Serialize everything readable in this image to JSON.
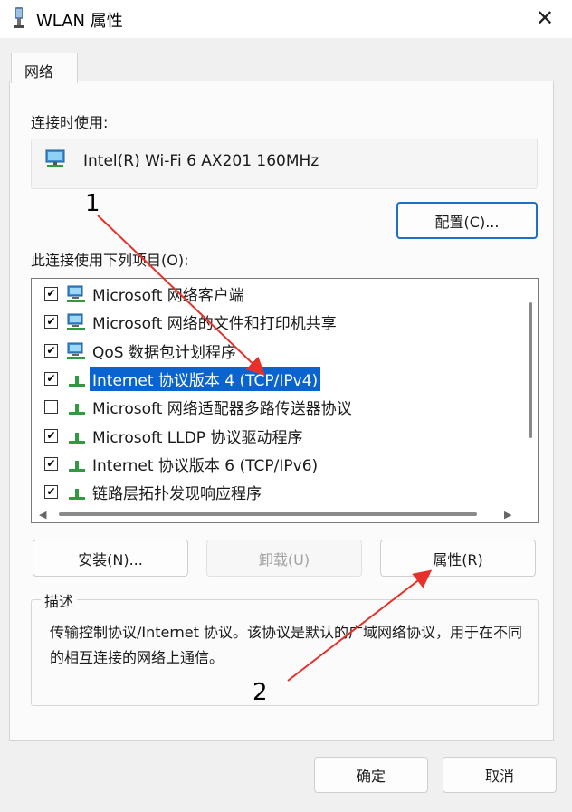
{
  "window": {
    "title": "WLAN 属性",
    "close_glyph": "✕"
  },
  "tabs": [
    {
      "label": "网络"
    }
  ],
  "connect_using": {
    "label": "连接时使用:",
    "adapter_name": "Intel(R) Wi-Fi 6 AX201 160MHz",
    "adapter_icon": "network-adapter-icon",
    "configure_button": "配置(C)..."
  },
  "items_section": {
    "label": "此连接使用下列项目(O):",
    "items": [
      {
        "checked": true,
        "icon": "client-network-icon",
        "label": "Microsoft 网络客户端",
        "selected": false
      },
      {
        "checked": true,
        "icon": "file-share-icon",
        "label": "Microsoft 网络的文件和打印机共享",
        "selected": false
      },
      {
        "checked": true,
        "icon": "qos-icon",
        "label": "QoS 数据包计划程序",
        "selected": false
      },
      {
        "checked": true,
        "icon": "protocol-icon",
        "label": "Internet 协议版本 4 (TCP/IPv4)",
        "selected": true
      },
      {
        "checked": false,
        "icon": "protocol-icon",
        "label": "Microsoft 网络适配器多路传送器协议",
        "selected": false
      },
      {
        "checked": true,
        "icon": "protocol-icon",
        "label": "Microsoft LLDP 协议驱动程序",
        "selected": false
      },
      {
        "checked": true,
        "icon": "protocol-icon",
        "label": "Internet 协议版本 6 (TCP/IPv6)",
        "selected": false
      },
      {
        "checked": true,
        "icon": "protocol-icon",
        "label": "链路层拓扑发现响应程序",
        "selected": false
      }
    ]
  },
  "item_buttons": {
    "install": "安装(N)...",
    "uninstall": "卸载(U)",
    "properties": "属性(R)"
  },
  "description": {
    "legend": "描述",
    "text": "传输控制协议/Internet 协议。该协议是默认的广域网络协议，用于在不同的相互连接的网络上通信。"
  },
  "footer": {
    "ok": "确定",
    "cancel": "取消"
  },
  "annotations": {
    "arrow1_number": "1",
    "arrow2_number": "2",
    "arrow_color": "#e8302a"
  },
  "colors": {
    "selection": "#0a64d0",
    "primary_border": "#1f6fc2"
  }
}
